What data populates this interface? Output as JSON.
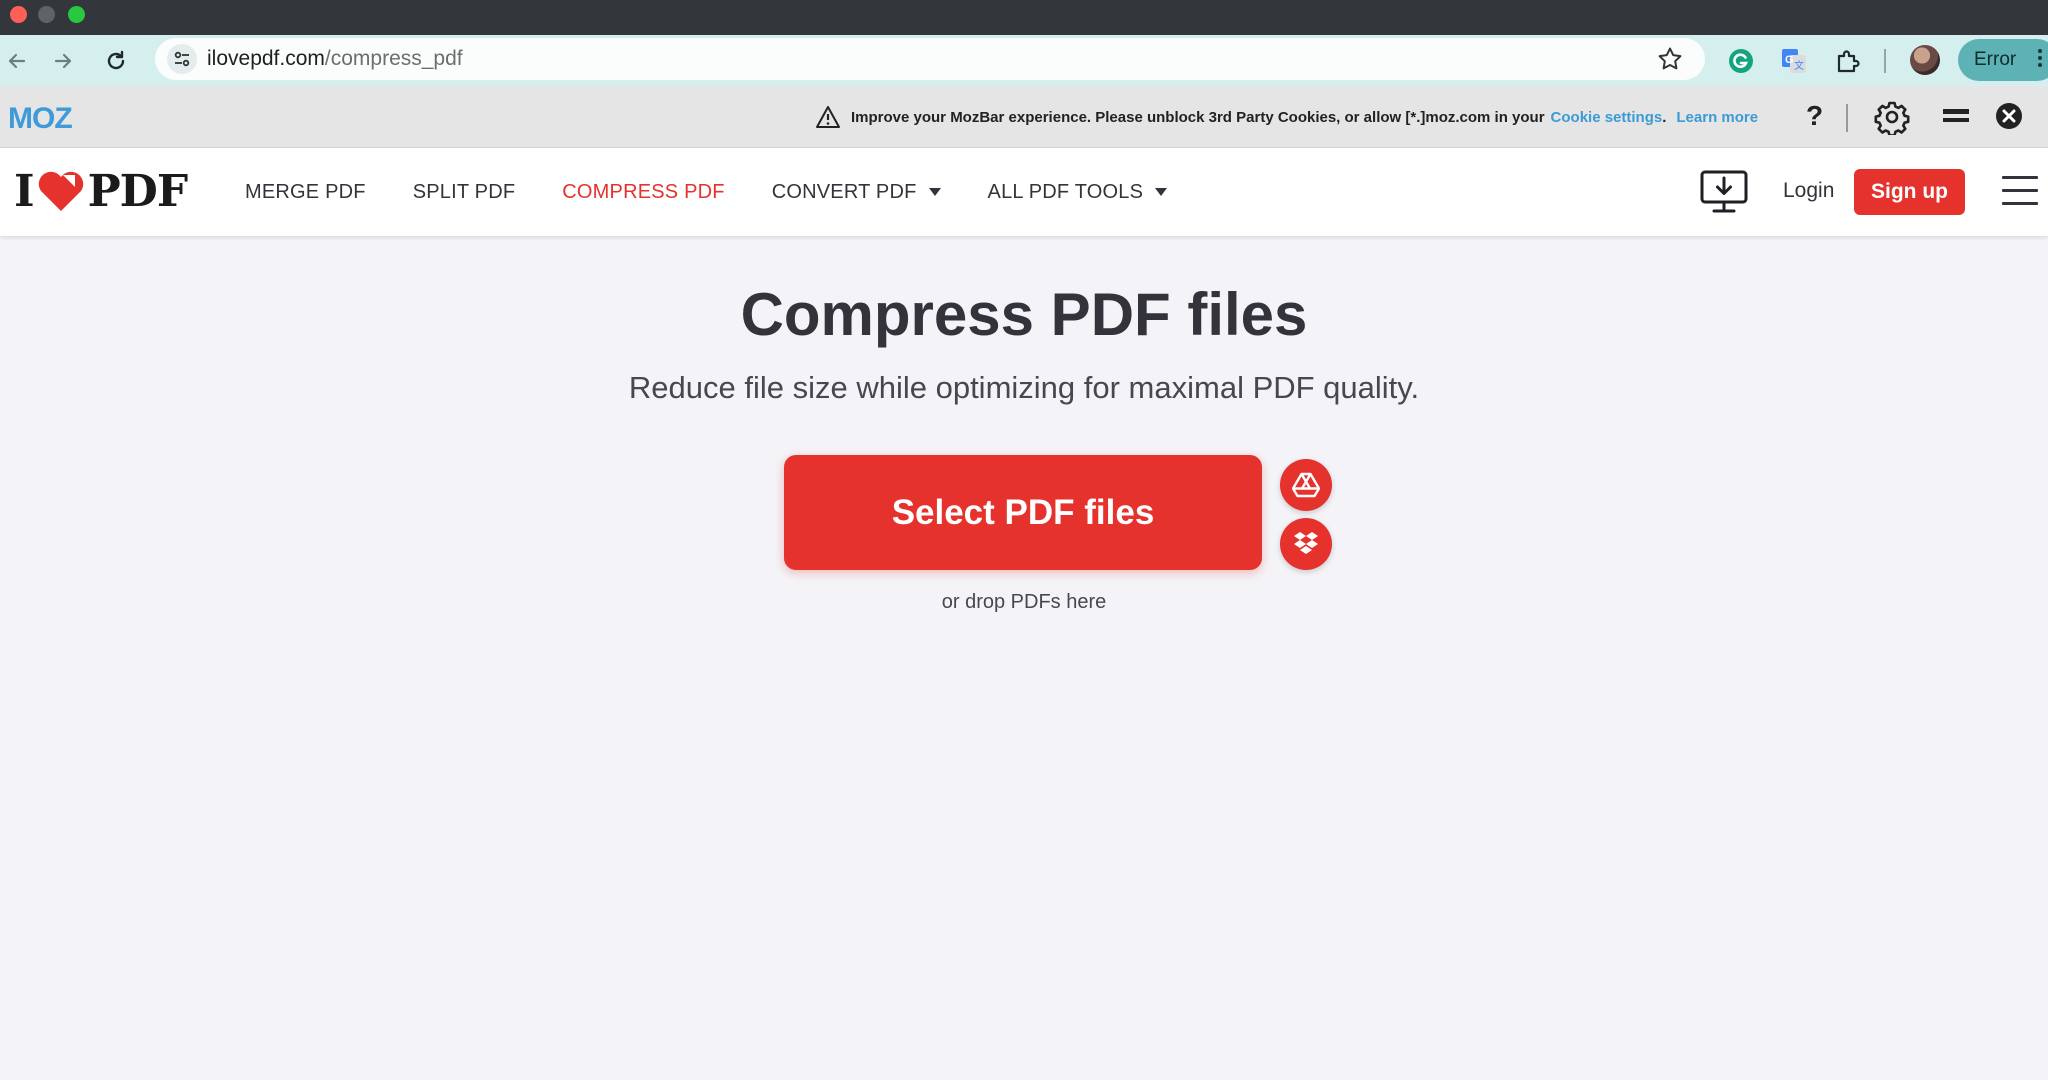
{
  "browser": {
    "url_domain": "ilovepdf.com",
    "url_path": "/compress_pdf",
    "profile_status": "Error"
  },
  "mozbar": {
    "logo": "MOZ",
    "message": "Improve your MozBar experience. Please unblock 3rd Party Cookies, or allow [*.]moz.com in your",
    "cookie_link": "Cookie settings",
    "message_end": ".",
    "learn_more": "Learn more",
    "help": "?"
  },
  "header": {
    "brand_left": "I",
    "brand_right": "PDF",
    "nav": [
      {
        "label": "MERGE PDF"
      },
      {
        "label": "SPLIT PDF"
      },
      {
        "label": "COMPRESS PDF"
      },
      {
        "label": "CONVERT PDF"
      },
      {
        "label": "ALL PDF TOOLS"
      }
    ],
    "login": "Login",
    "signup": "Sign up"
  },
  "main": {
    "title": "Compress PDF files",
    "subtitle": "Reduce file size while optimizing for maximal PDF quality.",
    "select_button": "Select PDF files",
    "drop_hint": "or drop PDFs here"
  },
  "colors": {
    "brand_red": "#e5322d",
    "moz_blue": "#3b9bd6",
    "text_dark": "#33333b",
    "page_bg": "#f4f4f8"
  }
}
